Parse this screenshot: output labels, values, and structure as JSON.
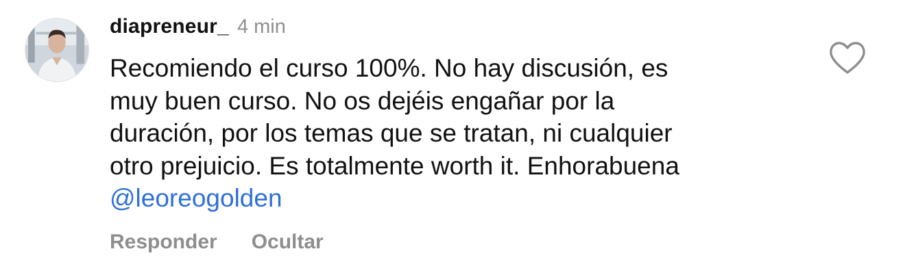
{
  "comment": {
    "avatar_icon": "user-profile-photo",
    "username": "diapreneur_",
    "timestamp": "4 min",
    "text_lines": [
      "Recomiendo el curso 100%. No hay discusión, es",
      "muy buen curso. No os dejéis engañar por la",
      "duración, por los temas que se tratan, ni cualquier",
      "otro prejuicio. Es totalmente worth it. Enhorabuena"
    ],
    "mention": "@leoreogolden",
    "mention_color": "#2e6fd9",
    "like_icon": "heart-outline-icon",
    "actions": {
      "reply_label": "Responder",
      "hide_label": "Ocultar"
    }
  }
}
